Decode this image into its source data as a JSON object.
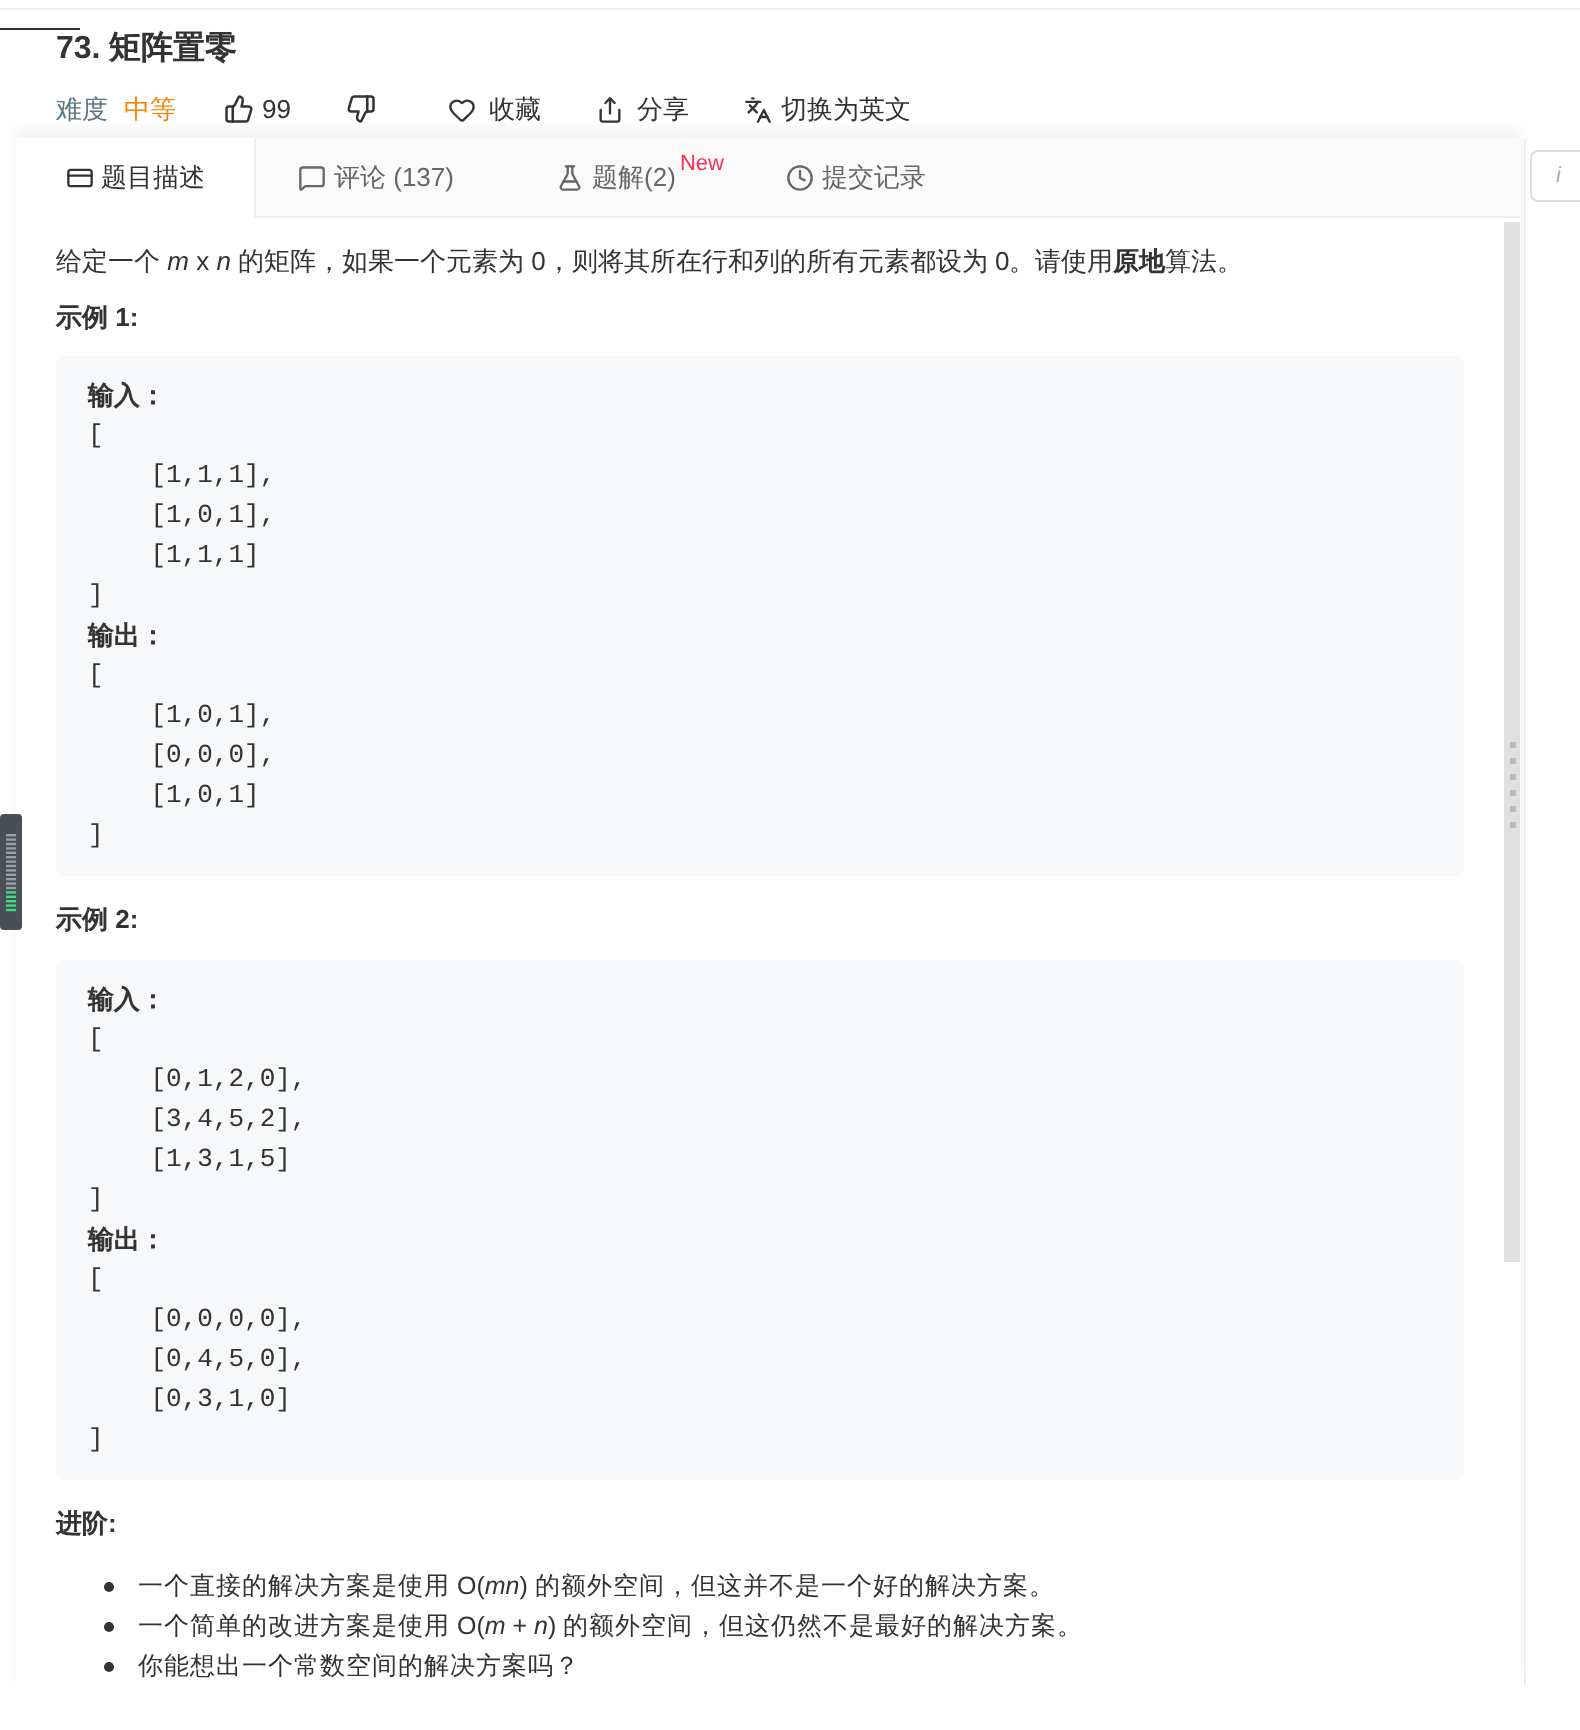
{
  "title": "73. 矩阵置零",
  "meta": {
    "difficulty_label": "难度",
    "difficulty": "中等",
    "likes": "99",
    "favorite": "收藏",
    "share": "分享",
    "switch_language": "切换为英文"
  },
  "tabs": [
    {
      "label": "题目描述",
      "kind": "description",
      "selected": true
    },
    {
      "label": "评论 (137)",
      "kind": "comments",
      "selected": false
    },
    {
      "label": "题解(2)",
      "kind": "solutions",
      "badge": "New",
      "selected": false
    },
    {
      "label": "提交记录",
      "kind": "submissions",
      "selected": false
    }
  ],
  "info_button": {
    "label": "i"
  },
  "description": "给定一个 *m* x *n* 的矩阵，如果一个元素为 0，则将其所在行和列的所有元素都设为 0。请使用**原地**算法。",
  "examples": [
    {
      "title": "示例 1:",
      "input_label": "输入：",
      "input": [
        "[",
        "    [1,1,1],",
        "    [1,0,1],",
        "    [1,1,1]",
        "]"
      ],
      "output_label": "输出：",
      "output": [
        "[",
        "    [1,0,1],",
        "    [0,0,0],",
        "    [1,0,1]",
        "]"
      ]
    },
    {
      "title": "示例 2:",
      "input_label": "输入：",
      "input": [
        "[",
        "    [0,1,2,0],",
        "    [3,4,5,2],",
        "    [1,3,1,5]",
        "]"
      ],
      "output_label": "输出：",
      "output": [
        "[",
        "    [0,0,0,0],",
        "    [0,4,5,0],",
        "    [0,3,1,0]",
        "]"
      ]
    }
  ],
  "follow_up": {
    "title": "进阶:",
    "items": [
      "一个直接的解决方案是使用  O(*mn*) 的额外空间，但这并不是一个好的解决方案。",
      "一个简单的改进方案是使用 O(*m* + *n*) 的额外空间，但这仍然不是最好的解决方案。",
      "你能想出一个常数空间的解决方案吗？"
    ]
  }
}
